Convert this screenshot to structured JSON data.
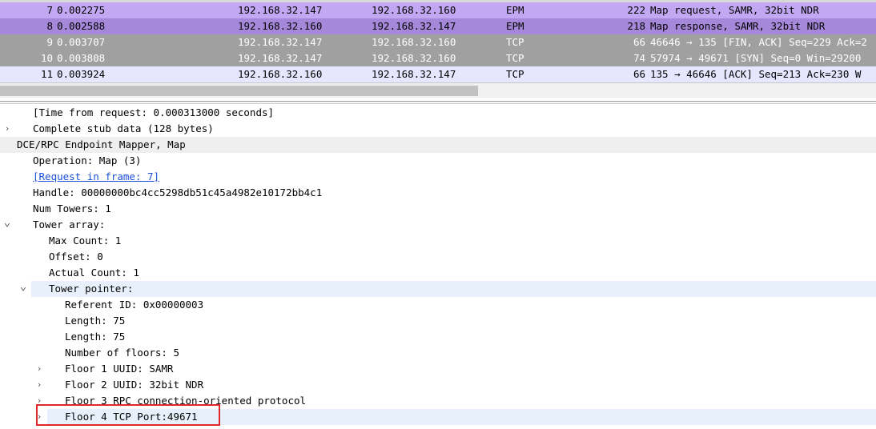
{
  "packet_list": {
    "rows": [
      {
        "no": "7",
        "time": "0.002275",
        "src": "192.168.32.147",
        "dst": "192.168.32.160",
        "proto": "EPM",
        "len": "222",
        "info": "Map request, SAMR, 32bit NDR",
        "bg": "#c2a8f2",
        "fg": "#000000"
      },
      {
        "no": "8",
        "time": "0.002588",
        "src": "192.168.32.160",
        "dst": "192.168.32.147",
        "proto": "EPM",
        "len": "218",
        "info": "Map response, SAMR, 32bit NDR",
        "bg": "#a688da",
        "fg": "#000000"
      },
      {
        "no": "9",
        "time": "0.003707",
        "src": "192.168.32.147",
        "dst": "192.168.32.160",
        "proto": "TCP",
        "len": "66",
        "info": "46646 → 135 [FIN, ACK] Seq=229 Ack=2",
        "bg": "#a0a0a0",
        "fg": "#ffffff"
      },
      {
        "no": "10",
        "time": "0.003808",
        "src": "192.168.32.147",
        "dst": "192.168.32.160",
        "proto": "TCP",
        "len": "74",
        "info": "57974 → 49671 [SYN] Seq=0 Win=29200",
        "bg": "#a0a0a0",
        "fg": "#ffffff"
      },
      {
        "no": "11",
        "time": "0.003924",
        "src": "192.168.32.160",
        "dst": "192.168.32.147",
        "proto": "TCP",
        "len": "66",
        "info": "135 → 46646 [ACK] Seq=213 Ack=230 W",
        "bg": "#e7e6ff",
        "fg": "#000000"
      }
    ]
  },
  "details": {
    "rows": [
      {
        "indent": 1,
        "arrow": "",
        "text": "[Time from request: 0.000313000 seconds]"
      },
      {
        "indent": 1,
        "arrow": "collapsed",
        "text": "Complete stub data (128 bytes)"
      },
      {
        "indent": 0,
        "arrow": "",
        "text": "DCE/RPC Endpoint Mapper, Map",
        "hl": "gray"
      },
      {
        "indent": 1,
        "arrow": "",
        "text": "Operation: Map (3)"
      },
      {
        "indent": 1,
        "arrow": "",
        "text": "[Request in frame: 7]",
        "link": true
      },
      {
        "indent": 1,
        "arrow": "",
        "text": "Handle: 00000000bc4cc5298db51c45a4982e10172bb4c1"
      },
      {
        "indent": 1,
        "arrow": "",
        "text": "Num Towers: 1"
      },
      {
        "indent": 1,
        "arrow": "expanded",
        "text": "Tower array:"
      },
      {
        "indent": 2,
        "arrow": "",
        "text": "Max Count: 1"
      },
      {
        "indent": 2,
        "arrow": "",
        "text": "Offset: 0"
      },
      {
        "indent": 2,
        "arrow": "",
        "text": "Actual Count: 1"
      },
      {
        "indent": 2,
        "arrow": "expanded",
        "text": "Tower pointer:",
        "hl": "blue"
      },
      {
        "indent": 3,
        "arrow": "",
        "text": "Referent ID: 0x00000003"
      },
      {
        "indent": 3,
        "arrow": "",
        "text": "Length: 75"
      },
      {
        "indent": 3,
        "arrow": "",
        "text": "Length: 75"
      },
      {
        "indent": 3,
        "arrow": "",
        "text": "Number of floors: 5"
      },
      {
        "indent": 3,
        "arrow": "collapsed",
        "text": "Floor 1 UUID: SAMR"
      },
      {
        "indent": 3,
        "arrow": "collapsed",
        "text": "Floor 2 UUID: 32bit NDR"
      },
      {
        "indent": 3,
        "arrow": "collapsed",
        "text": "Floor 3 RPC connection-oriented protocol"
      },
      {
        "indent": 3,
        "arrow": "collapsed",
        "text": "Floor 4 TCP Port:49671",
        "hl": "blue"
      }
    ]
  },
  "annotation": {
    "color": "#e0282a",
    "target": "Floor 4 TCP Port:49671"
  }
}
